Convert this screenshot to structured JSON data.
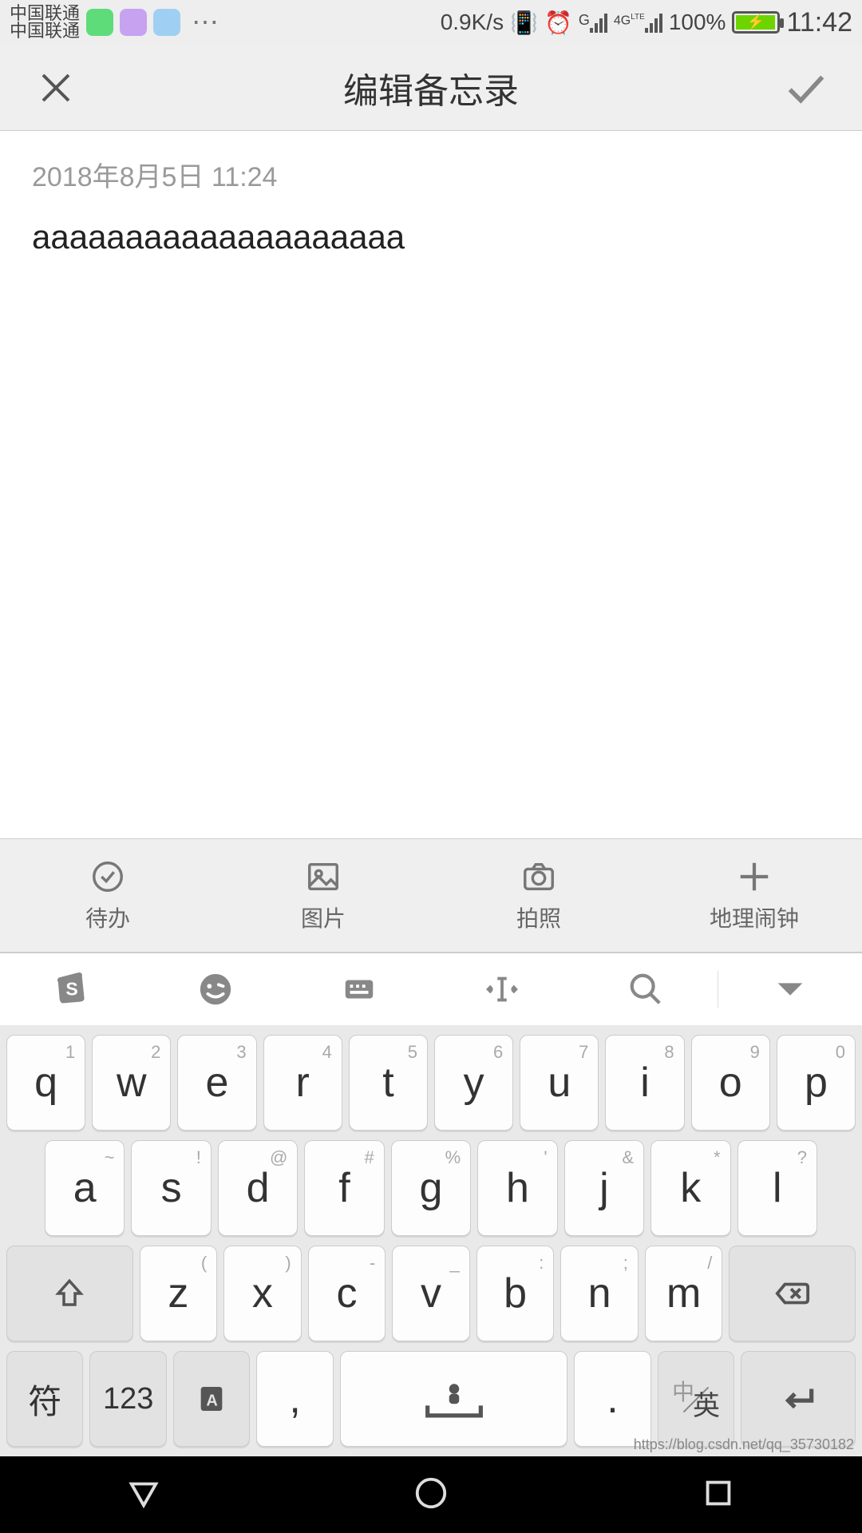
{
  "status": {
    "carrier": "中国联通",
    "speed": "0.9K/s",
    "net_label_g": "G",
    "net_label_4g": "4G",
    "net_label_lte": "LTE",
    "battery_pct": "100%",
    "time": "11:42"
  },
  "header": {
    "title": "编辑备忘录"
  },
  "note": {
    "timestamp": "2018年8月5日 11:24",
    "content": "aaaaaaaaaaaaaaaaaaaa"
  },
  "toolbar": {
    "todo": "待办",
    "image": "图片",
    "camera": "拍照",
    "geo": "地理闹钟"
  },
  "keyboard": {
    "row1": [
      {
        "sup": "1",
        "main": "q"
      },
      {
        "sup": "2",
        "main": "w"
      },
      {
        "sup": "3",
        "main": "e"
      },
      {
        "sup": "4",
        "main": "r"
      },
      {
        "sup": "5",
        "main": "t"
      },
      {
        "sup": "6",
        "main": "y"
      },
      {
        "sup": "7",
        "main": "u"
      },
      {
        "sup": "8",
        "main": "i"
      },
      {
        "sup": "9",
        "main": "o"
      },
      {
        "sup": "0",
        "main": "p"
      }
    ],
    "row2": [
      {
        "sup": "~",
        "main": "a"
      },
      {
        "sup": "!",
        "main": "s"
      },
      {
        "sup": "@",
        "main": "d"
      },
      {
        "sup": "#",
        "main": "f"
      },
      {
        "sup": "%",
        "main": "g"
      },
      {
        "sup": "'",
        "main": "h"
      },
      {
        "sup": "&",
        "main": "j"
      },
      {
        "sup": "*",
        "main": "k"
      },
      {
        "sup": "?",
        "main": "l"
      }
    ],
    "row3": [
      {
        "sup": "(",
        "main": "z"
      },
      {
        "sup": ")",
        "main": "x"
      },
      {
        "sup": "-",
        "main": "c"
      },
      {
        "sup": "_",
        "main": "v"
      },
      {
        "sup": ":",
        "main": "b"
      },
      {
        "sup": ";",
        "main": "n"
      },
      {
        "sup": "/",
        "main": "m"
      }
    ],
    "row4": {
      "sym": "符",
      "num": "123",
      "comma": ",",
      "period": ".",
      "cn": "中",
      "en": "英"
    }
  },
  "watermark": "https://blog.csdn.net/qq_35730182"
}
